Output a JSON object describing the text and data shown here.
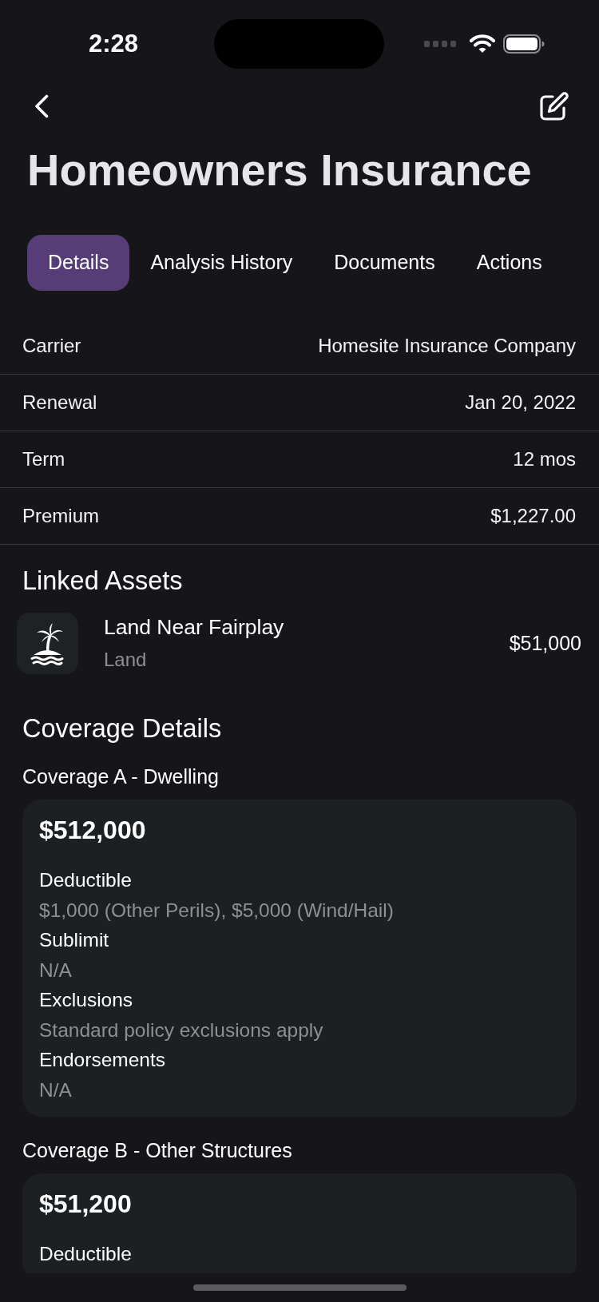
{
  "status_bar": {
    "time": "2:28"
  },
  "header": {
    "title": "Homeowners Insurance"
  },
  "tabs": [
    {
      "label": "Details",
      "selected": true
    },
    {
      "label": "Analysis History",
      "selected": false
    },
    {
      "label": "Documents",
      "selected": false
    },
    {
      "label": "Actions",
      "selected": false
    }
  ],
  "policy_details": [
    {
      "label": "Carrier",
      "value": "Homesite Insurance Company"
    },
    {
      "label": "Renewal",
      "value": "Jan 20, 2022"
    },
    {
      "label": "Term",
      "value": "12 mos"
    },
    {
      "label": "Premium",
      "value": "$1,227.00"
    }
  ],
  "linked_assets": {
    "heading": "Linked Assets",
    "items": [
      {
        "name": "Land Near Fairplay",
        "type": "Land",
        "value": "$51,000"
      }
    ]
  },
  "coverage_details": {
    "heading": "Coverage Details",
    "sections": [
      {
        "title": "Coverage A - Dwelling",
        "amount": "$512,000",
        "fields": [
          {
            "label": "Deductible",
            "value": "$1,000 (Other Perils), $5,000 (Wind/Hail)"
          },
          {
            "label": "Sublimit",
            "value": "N/A"
          },
          {
            "label": "Exclusions",
            "value": "Standard policy exclusions apply"
          },
          {
            "label": "Endorsements",
            "value": "N/A"
          }
        ]
      },
      {
        "title": "Coverage B - Other Structures",
        "amount": "$51,200",
        "fields": [
          {
            "label": "Deductible"
          }
        ]
      }
    ]
  }
}
